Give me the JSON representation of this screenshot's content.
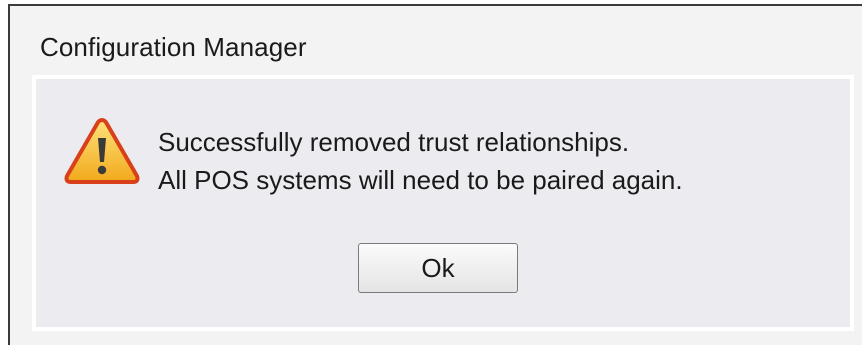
{
  "dialog": {
    "title": "Configuration Manager",
    "icon": "warning-icon",
    "message_lines": [
      "Successfully removed trust relationships.",
      "All POS systems will need to be paired again."
    ],
    "ok_label": "Ok"
  },
  "colors": {
    "icon_fill": "#f7c238",
    "icon_border": "#d9401a",
    "body_bg": "#ececf0",
    "frame_bg": "#f3f3f3"
  }
}
